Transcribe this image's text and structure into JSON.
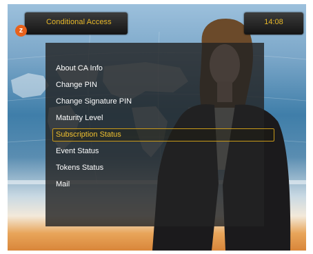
{
  "header": {
    "title": "Conditional Access",
    "time": "14:08",
    "channel_logo_text": "z"
  },
  "menu": {
    "items": [
      {
        "label": "About CA Info"
      },
      {
        "label": "Change PIN"
      },
      {
        "label": "Change Signature PIN"
      },
      {
        "label": "Maturity Level"
      },
      {
        "label": "Subscription Status",
        "selected": true
      },
      {
        "label": "Event Status"
      },
      {
        "label": "Tokens Status"
      },
      {
        "label": "Mail"
      }
    ]
  },
  "colors": {
    "accent": "#e8b828",
    "selection_border": "#c99a1a",
    "panel": "#232323",
    "logo": "#e8621c"
  }
}
